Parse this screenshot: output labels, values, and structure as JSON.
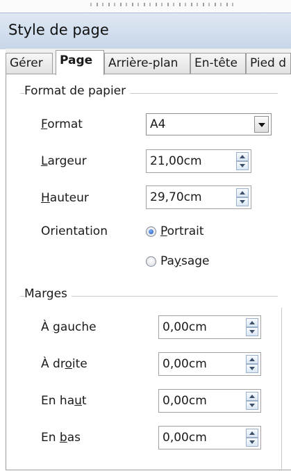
{
  "window": {
    "title": "Style de page"
  },
  "tabs": [
    {
      "label": "Gérer",
      "active": false
    },
    {
      "label": "Page",
      "active": true
    },
    {
      "label": "Arrière-plan",
      "active": false
    },
    {
      "label": "En-tête",
      "active": false
    },
    {
      "label": "Pied d",
      "active": false
    }
  ],
  "paper_format": {
    "group_label": "Format de papier",
    "format": {
      "label_pre": "",
      "label_key": "F",
      "label_post": "ormat",
      "value": "A4"
    },
    "width": {
      "label_pre": "",
      "label_key": "L",
      "label_post": "argeur",
      "value": "21,00cm"
    },
    "height": {
      "label_pre": "",
      "label_key": "H",
      "label_post": "auteur",
      "value": "29,70cm"
    },
    "orientation": {
      "label": "Orientation",
      "portrait": {
        "label_pre": "",
        "label_key": "P",
        "label_post": "ortrait",
        "checked": true
      },
      "landscape": {
        "label_pre": "Pa",
        "label_key": "y",
        "label_post": "sage",
        "checked": false
      }
    }
  },
  "margins": {
    "group_label": "Marges",
    "left": {
      "label_pre": "À ",
      "label_key": "g",
      "label_post": "auche",
      "value": "0,00cm"
    },
    "right": {
      "label_pre": "À dr",
      "label_key": "o",
      "label_post": "ite",
      "value": "0,00cm"
    },
    "top": {
      "label_pre": "En ha",
      "label_key": "u",
      "label_post": "t",
      "value": "0,00cm"
    },
    "bottom": {
      "label_pre": "En ",
      "label_key": "b",
      "label_post": "as",
      "value": "0,00cm"
    }
  }
}
